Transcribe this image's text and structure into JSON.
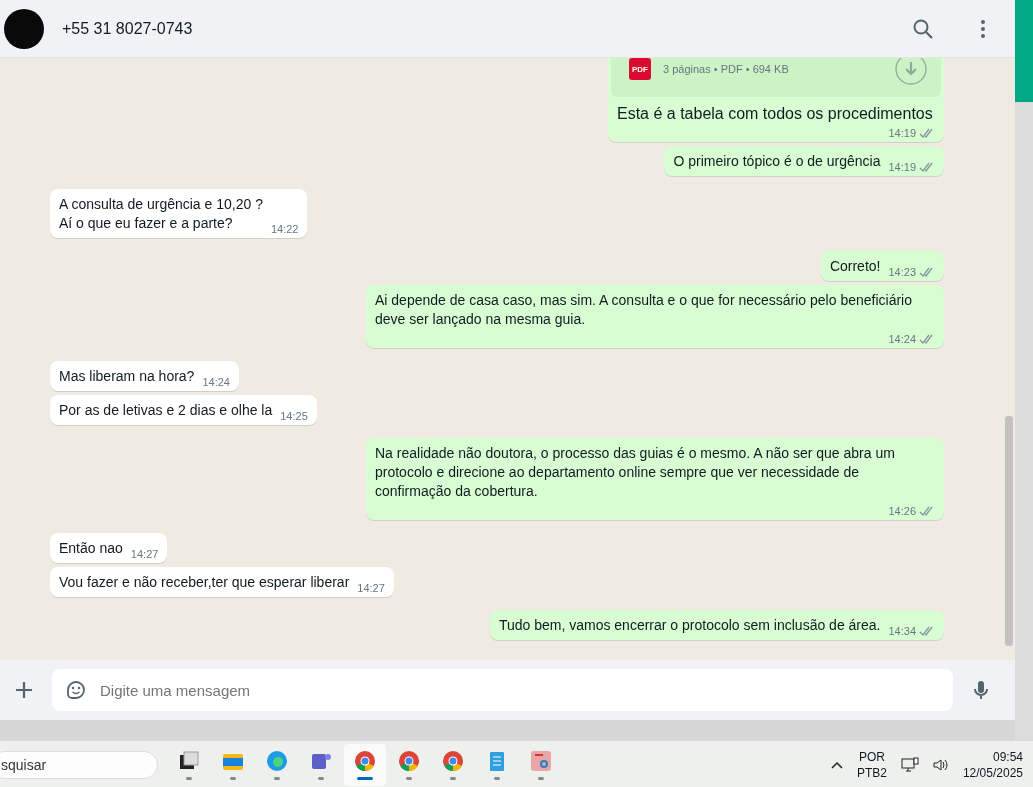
{
  "header": {
    "contact": "+55 31 8027-0743"
  },
  "attachment": {
    "file_type": "PDF",
    "meta": "3 páginas • PDF • 694 KB",
    "caption": "Esta é a tabela com todos os procedimentos",
    "time": "14:19",
    "read": false
  },
  "messages": [
    {
      "outgoing": true,
      "text": "O primeiro tópico é o de urgência",
      "time": "14:19",
      "read": false
    },
    {
      "outgoing": false,
      "text": "A consulta de urgência e 10,20 ?\nAí o que eu fazer e a parte?",
      "time": "14:22"
    },
    {
      "outgoing": true,
      "text": "Correto!",
      "time": "14:23",
      "read": false
    },
    {
      "outgoing": true,
      "text": "Ai depende de casa caso, mas sim. A consulta e o que for necessário pelo beneficiário deve ser lançado na mesma guia.",
      "time": "14:24",
      "read": false
    },
    {
      "outgoing": false,
      "text": "Mas liberam na hora?",
      "time": "14:24"
    },
    {
      "outgoing": false,
      "text": "Por as de letivas e 2 dias e olhe la",
      "time": "14:25"
    },
    {
      "outgoing": true,
      "text": "Na realidade não doutora, o processo das guias é o mesmo. A não ser que abra um protocolo e direcione ao departamento online sempre que ver necessidade de confirmação da cobertura.",
      "time": "14:26",
      "read": false
    },
    {
      "outgoing": false,
      "text": "Então nao",
      "time": "14:27"
    },
    {
      "outgoing": false,
      "text": "Vou fazer e não receber,ter que esperar liberar",
      "time": "14:27"
    },
    {
      "outgoing": true,
      "text": "Tudo bem, vamos encerrar o protocolo sem inclusão de área.",
      "time": "14:34",
      "read": false
    }
  ],
  "composer": {
    "placeholder": "Digite uma mensagem"
  },
  "taskbar": {
    "search": {
      "value": "squisar"
    },
    "apps": [
      {
        "kind": "taskview",
        "selected": false
      },
      {
        "kind": "folder",
        "selected": false
      },
      {
        "kind": "edge",
        "selected": false
      },
      {
        "kind": "teams",
        "selected": false
      },
      {
        "kind": "chrome",
        "selected": true
      },
      {
        "kind": "chrome",
        "selected": false
      },
      {
        "kind": "chrome",
        "selected": false
      },
      {
        "kind": "notepad",
        "selected": false
      },
      {
        "kind": "snip",
        "selected": false
      }
    ],
    "language": "POR",
    "layout": "PTB2",
    "time": "09:54",
    "date": "12/05/2025"
  }
}
